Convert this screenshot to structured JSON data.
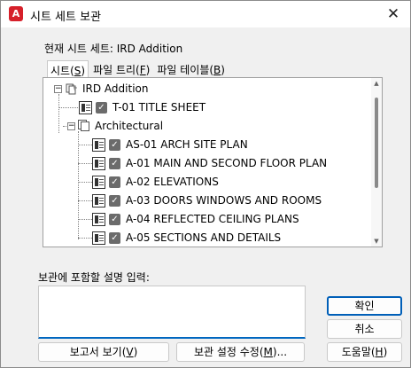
{
  "window": {
    "title": "시트 세트 보관",
    "app_icon_letter": "A"
  },
  "current_sheet": "현재 시트 세트: IRD Addition",
  "tabs": [
    {
      "label": "시트(",
      "key": "S",
      "suffix": ")"
    },
    {
      "label": "파일 트리(",
      "key": "F",
      "suffix": ")"
    },
    {
      "label": "파일 테이블(",
      "key": "B",
      "suffix": ")"
    }
  ],
  "tree": {
    "root_label": "IRD Addition",
    "root_sheet": "T-01 TITLE SHEET",
    "subset_label": "Architectural",
    "sheets": [
      "AS-01 ARCH SITE PLAN",
      "A-01 MAIN AND SECOND FLOOR PLAN",
      "A-02 ELEVATIONS",
      "A-03 DOORS WINDOWS AND ROOMS",
      "A-04 REFLECTED CEILING PLANS",
      "A-05 SECTIONS AND DETAILS"
    ]
  },
  "description": {
    "label": "보관에 포함할 설명 입력:",
    "value": ""
  },
  "buttons": {
    "view_report": {
      "label": "보고서 보기(",
      "key": "V",
      "suffix": ")"
    },
    "modify_settings": {
      "label": "보관 설정 수정(",
      "key": "M",
      "suffix": ")..."
    },
    "ok": "확인",
    "cancel": "취소",
    "help": {
      "label": "도움말(",
      "key": "H",
      "suffix": ")"
    }
  },
  "colors": {
    "accent": "#005fb8",
    "app_icon": "#d6202a"
  }
}
